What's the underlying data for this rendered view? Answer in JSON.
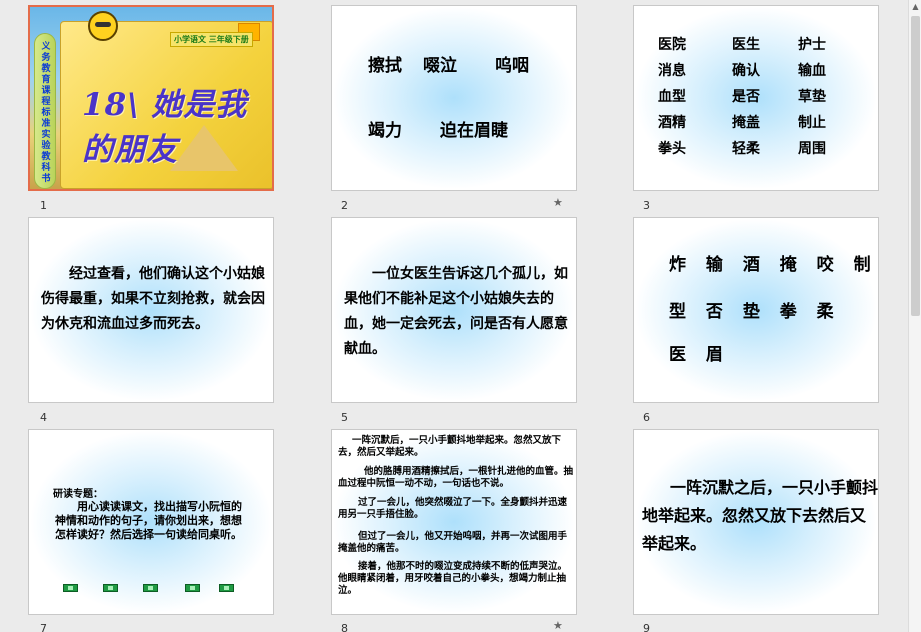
{
  "slides": [
    {
      "num": "1",
      "title": "18\\ 她是我的朋友",
      "tag": "小学语文  三年级下册",
      "spine": "义务教育课程标准实验教科书"
    },
    {
      "num": "2",
      "line1a": "擦拭",
      "line1b": "啜泣",
      "line1c": "呜咽",
      "line2a": "竭力",
      "line2b": "迫在眉睫",
      "star": "★"
    },
    {
      "num": "3",
      "grid": [
        [
          "医院",
          "医生",
          "护士"
        ],
        [
          "消息",
          "确认",
          "输血"
        ],
        [
          "血型",
          "是否",
          "草垫"
        ],
        [
          "酒精",
          "掩盖",
          "制止"
        ],
        [
          "拳头",
          "轻柔",
          "周围"
        ]
      ]
    },
    {
      "num": "4",
      "text": "经过查看，他们确认这个小姑娘伤得最重，如果不立刻抢救，就会因为休克和流血过多而死去。"
    },
    {
      "num": "5",
      "text": "一位女医生告诉这几个孤儿，如果他们不能补足这个小姑娘失去的血，她一定会死去，问是否有人愿意献血。"
    },
    {
      "num": "6",
      "row1": "炸 输 酒 掩 咬 制",
      "row2": "型 否 垫 拳 柔",
      "row3": "医 眉"
    },
    {
      "num": "7",
      "heading": "研读专题：",
      "text": "用心读读课文，找出描写小阮恒的神情和动作的句子，请你划出来，想想怎样读好？然后选择一句读给同桌听。"
    },
    {
      "num": "8",
      "p1": "一阵沉默后，一只小手颤抖地举起来。忽然又放下去，然后又举起来。",
      "p2": "他的胳膊用酒精擦拭后，一根针扎进他的血管。抽血过程中阮恒一动不动，一句话也不说。",
      "p3": "过了一会儿，他突然啜泣了一下。全身颤抖并迅速用另一只手捂住脸。",
      "p4": "但过了一会儿，他又开始呜咽，并再一次试图用手掩盖他的痛苦。",
      "p5": "接着，他那不时的啜泣变成持续不断的低声哭泣。他眼睛紧闭着，用牙咬着自己的小拳头，想竭力制止抽泣。",
      "star": "★"
    },
    {
      "num": "9",
      "text": "一阵沉默之后，一只小手颤抖地举起来。忽然又放下去然后又举起来。"
    }
  ],
  "colors": {
    "selection": "#e46c4a",
    "title": "#4a34c9",
    "glow": "#aee0fb"
  }
}
